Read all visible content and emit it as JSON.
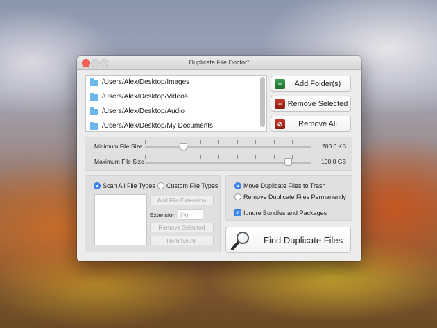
{
  "window": {
    "title": "Duplicate File Doctor*"
  },
  "folders": [
    {
      "path": "/Users/Alex/Desktop/Images"
    },
    {
      "path": "/Users/Alex/Desktop/Videos"
    },
    {
      "path": "/Users/Alex/Desktop/Audio"
    },
    {
      "path": "/Users/Alex/Desktop/My Documents"
    }
  ],
  "folder_buttons": {
    "add": "Add Folder(s)",
    "remove_selected": "Remove Selected",
    "remove_all": "Remove All"
  },
  "file_size": {
    "minimum": {
      "label": "Minimum File Size",
      "value": "200.0 KB",
      "slider_fraction": 0.23
    },
    "maximum": {
      "label": "Maximum File Size",
      "value": "100.0 GB",
      "slider_fraction": 0.86
    }
  },
  "file_types": {
    "scan_all": "Scan All File Types",
    "custom": "Custom File Types",
    "selected": "scan_all",
    "add_extension": "Add File Extension",
    "extension_label": "Extension",
    "extension_placeholder": "jpg",
    "remove_selected": "Remove Selected",
    "remove_all": "Remove All"
  },
  "duplicate_handling": {
    "move_to_trash": "Move Duplicate Files to Trash",
    "remove_permanently": "Remove Duplicate Files Permanently",
    "selected": "move_to_trash",
    "ignore_bundles": "Ignore Bundles and Packages",
    "ignore_bundles_checked": true
  },
  "find_button": "Find Duplicate Files",
  "colors": {
    "accent": "#3d8cf7",
    "close": "#fc5f57",
    "folder": "#6bb6ea"
  }
}
